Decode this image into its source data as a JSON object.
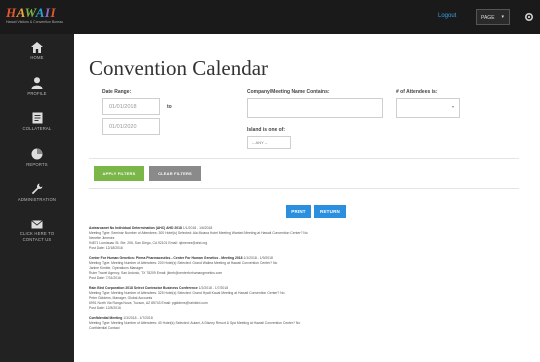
{
  "header": {
    "logo_text": [
      "H",
      "A",
      "W",
      "A",
      "I",
      "I"
    ],
    "logo_tagline": "Hawaii Visitors & Convention Bureau",
    "logout": "Logout",
    "page_select": "PAGE"
  },
  "sidebar": {
    "items": [
      {
        "label": "HOME",
        "icon": "home-icon"
      },
      {
        "label": "PROFILE",
        "icon": "user-icon"
      },
      {
        "label": "COLLATERAL",
        "icon": "document-icon"
      },
      {
        "label": "REPORTS",
        "icon": "pie-chart-icon"
      },
      {
        "label": "ADMINISTRATION",
        "icon": "wrench-icon"
      },
      {
        "label_line1": "CLICK HERE TO",
        "label_line2": "CONTACT US",
        "icon": "envelope-icon"
      }
    ]
  },
  "main": {
    "title": "Convention Calendar",
    "date_range": {
      "label": "Date Range:",
      "from": "01/01/2018",
      "to_label": "to",
      "to": "01/01/2020"
    },
    "company": {
      "label": "Company/Meeting Name Contains:",
      "value": ""
    },
    "attendees": {
      "label": "# of Attendees is:",
      "value": ""
    },
    "island": {
      "label": "Island is one of:",
      "value": "-- ANY --"
    },
    "buttons": {
      "apply": "APPLY FILTERS",
      "clear": "CLEAR FILTERS",
      "print": "PRINT",
      "return": "RETURN"
    },
    "results": [
      {
        "title": "Aotearoanet No Individual Determination (AHC) AHD 2018",
        "dates": "1/1/2018 - 1/6/2018",
        "l2": "Meeting Type: Seminar Number of Attendees: 300 Hotel(s) Selected: Ala Moana Hotel Meeting Wanted Meeting at Hawaii Convention Center? No",
        "l3": "Nenette Jimenez",
        "l4": "94871 Lumiauau St. Ste. 206, San Diego, CA 92101 Email: njimenez@ahd.org",
        "l5": "Post Date: 12/18/2016"
      },
      {
        "title": "Center For Human Genetics: Pirma Pharmaceutics - Center For Human Genetics - Meeting 2018",
        "dates": "1/1/2018 - 1/9/2018",
        "l2": "Meeting Type: Meeting Number of Attendees: 200 Hotel(s) Selected: Grand Wailea Meeting at Hawaii Convention Center? No",
        "l3": "Janine Kimble, Operations Manager",
        "l4": "Ruler Travel Agency, San Antonio, TX 78209 Email: jkimb@centerforhumangenetics.com",
        "l5": "Post Date: 7/31/2016"
      },
      {
        "title": "Rain Bird Corporation 2018 Select Contractor Business Conference",
        "dates": "1/2/2018 - 1/7/2018",
        "l2": "Meeting Type: Meeting Number of Attendees: 325 Hotel(s) Selected: Grand Hyatt Kauai Meeting at Hawaii Convention Center? No",
        "l3": "Peter Giddens, Manager, Global Accounts",
        "l4": "6991 North Via Ranga Nova, Tucson, AZ 85743 Email: pgiddens@rainbird.com",
        "l5": "Post Date: 12/8/2016"
      },
      {
        "title": "Confidential Meeting",
        "dates": "1/3/2018 - 1/7/2018",
        "l2": "Meeting Type: Meeting Number of Attendees: 40 Hotel(s) Selected: Aulani, A Disney Resort & Spa Meeting at Hawaii Convention Center? No",
        "l3": "Confidential Contact",
        "l4": "",
        "l5": ""
      }
    ]
  },
  "colors": {
    "topbar": "#1a1a1a",
    "sidebar": "#222222",
    "apply_button": "#7ab648",
    "clear_button": "#8a8a8a",
    "action_button": "#2b8fe0",
    "link": "#3aa0e8"
  }
}
